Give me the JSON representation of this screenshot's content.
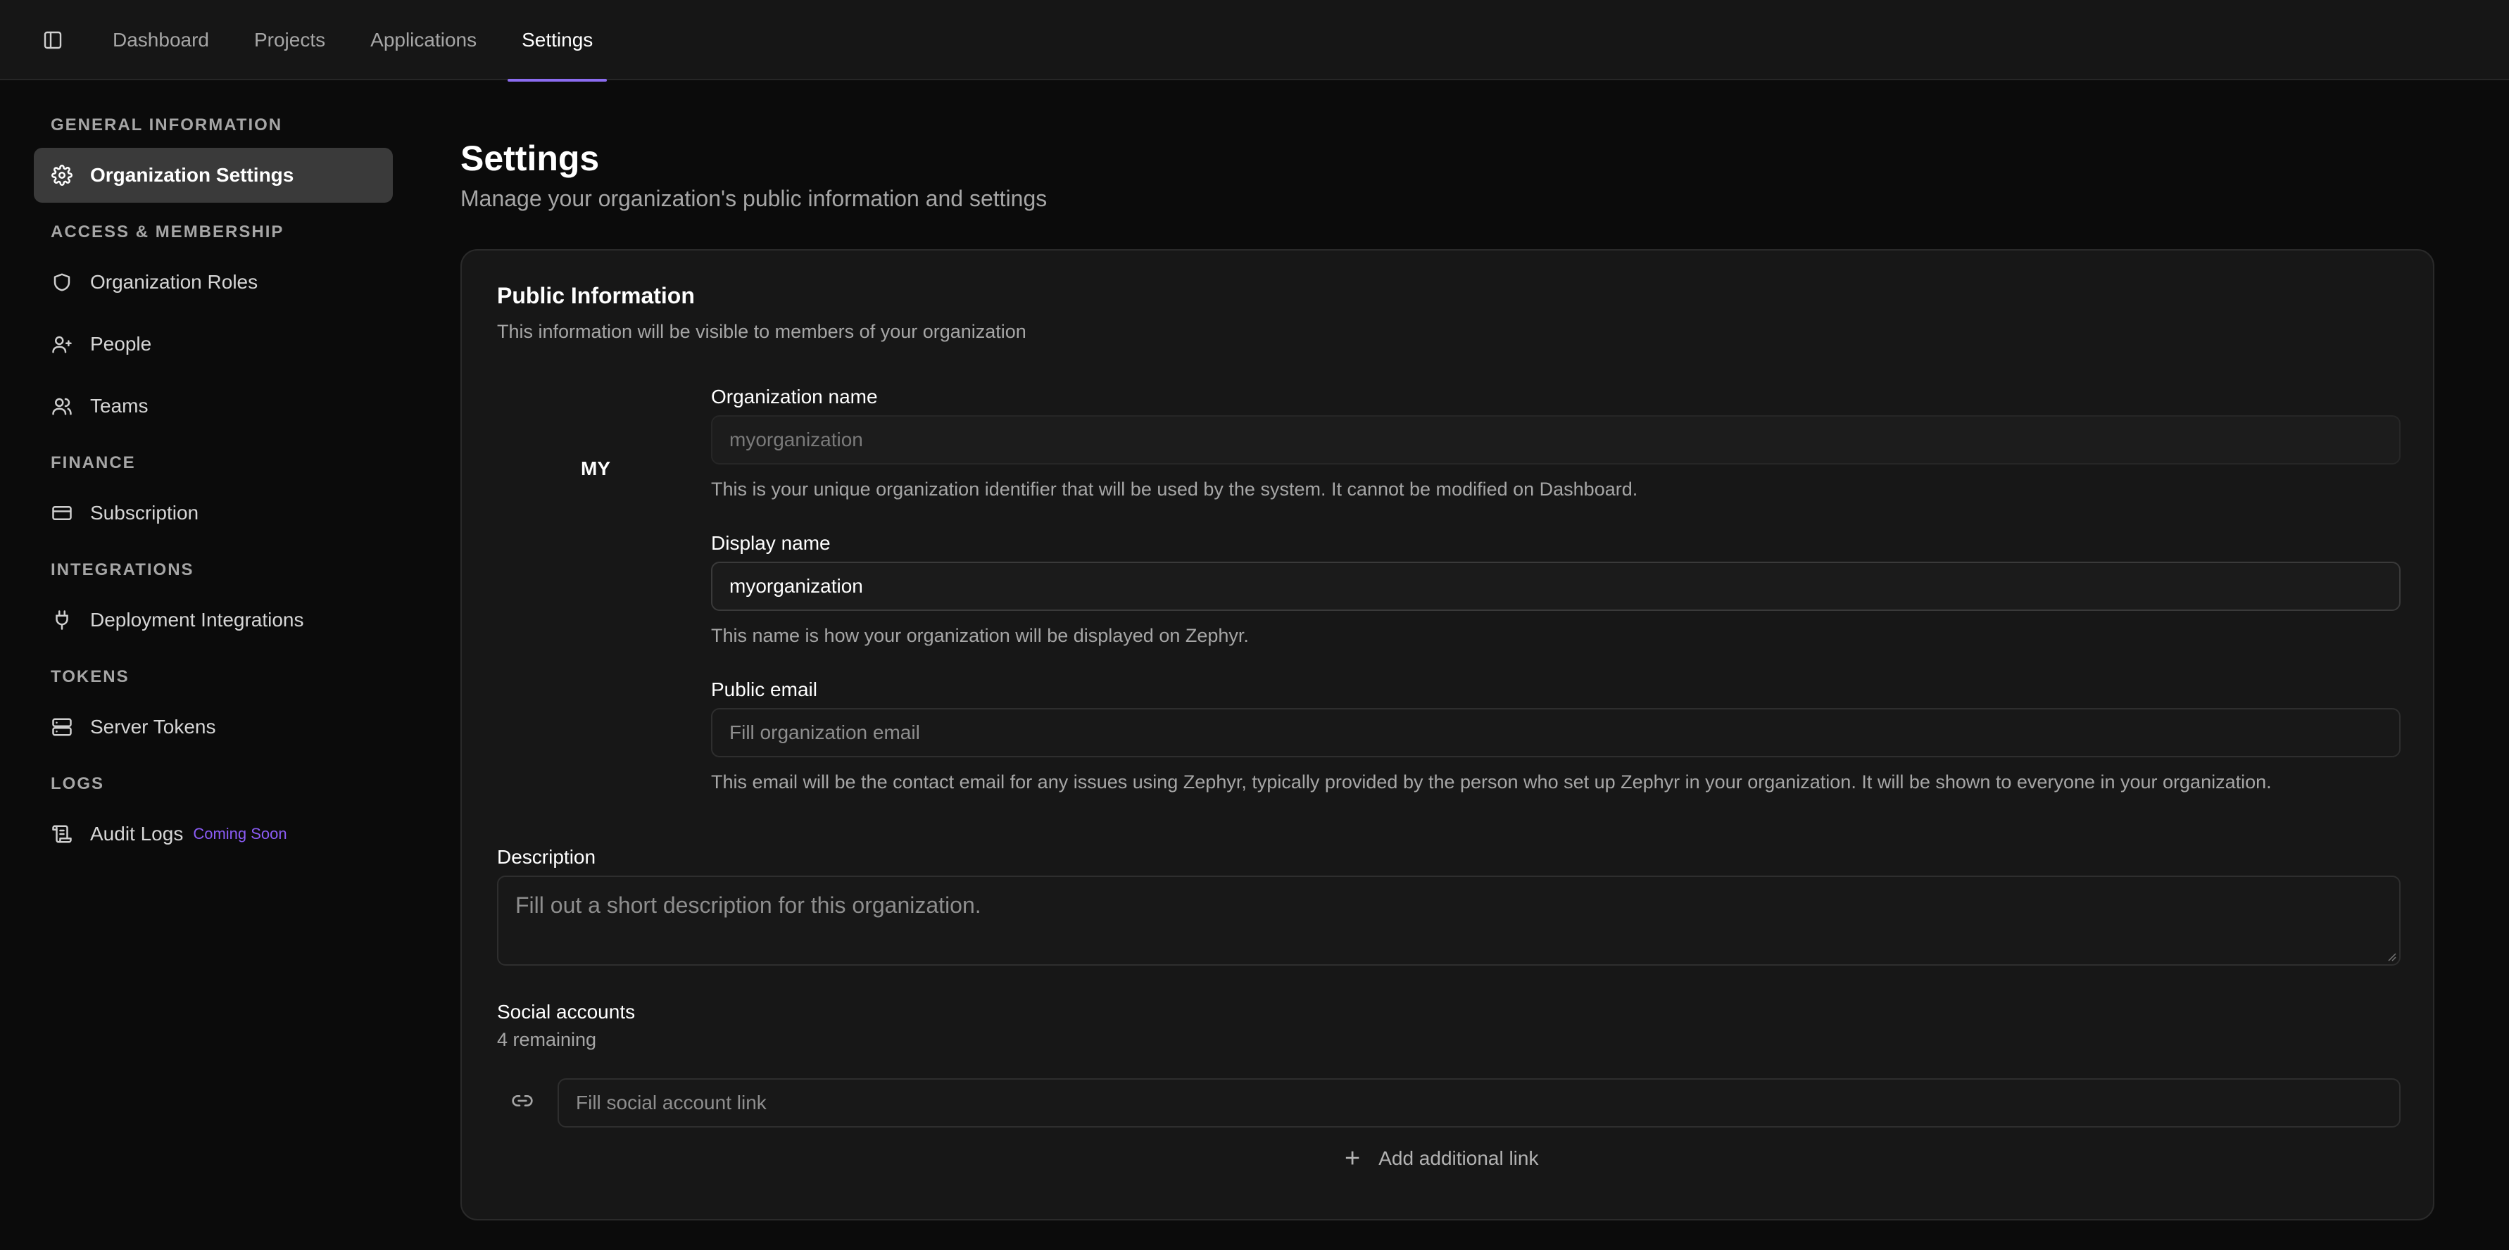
{
  "nav": {
    "tabs": [
      {
        "label": "Dashboard"
      },
      {
        "label": "Projects"
      },
      {
        "label": "Applications"
      },
      {
        "label": "Settings"
      }
    ]
  },
  "sidebar": {
    "sections": [
      {
        "title": "GENERAL INFORMATION"
      },
      {
        "title": "ACCESS & MEMBERSHIP"
      },
      {
        "title": "FINANCE"
      },
      {
        "title": "INTEGRATIONS"
      },
      {
        "title": "TOKENS"
      },
      {
        "title": "LOGS"
      }
    ],
    "items": [
      {
        "label": "Organization Settings",
        "icon": "gear-icon"
      },
      {
        "label": "Organization Roles",
        "icon": "shield-icon"
      },
      {
        "label": "People",
        "icon": "user-icon"
      },
      {
        "label": "Teams",
        "icon": "users-icon"
      },
      {
        "label": "Subscription",
        "icon": "credit-card-icon"
      },
      {
        "label": "Deployment Integrations",
        "icon": "plug-icon"
      },
      {
        "label": "Server Tokens",
        "icon": "server-icon"
      },
      {
        "label": "Audit Logs",
        "icon": "scroll-icon",
        "badge": "Coming Soon"
      }
    ]
  },
  "main": {
    "title": "Settings",
    "subtitle": "Manage your organization's public information and settings",
    "card": {
      "title": "Public Information",
      "description": "This information will be visible to members of your organization",
      "avatar_initials": "MY",
      "org_name": {
        "label": "Organization name",
        "placeholder": "myorganization",
        "help": "This is your unique organization identifier that will be used by the system. It cannot be modified on Dashboard."
      },
      "display_name": {
        "label": "Display name",
        "value": "myorganization",
        "help": "This name is how your organization will be displayed on Zephyr."
      },
      "public_email": {
        "label": "Public email",
        "placeholder": "Fill organization email",
        "help": "This email will be the contact email for any issues using Zephyr, typically provided by the person who set up Zephyr in your organization. It will be shown to everyone in your organization."
      },
      "description_field": {
        "label": "Description",
        "placeholder": "Fill out a short description for this organization."
      },
      "social": {
        "label": "Social accounts",
        "remaining": "4 remaining",
        "placeholder": "Fill social account link",
        "add_label": "Add additional link"
      }
    }
  },
  "colors": {
    "accent": "#8b6cf0",
    "badge": "#8b5cf6",
    "background": "#0b0b0b",
    "card": "#171717"
  }
}
